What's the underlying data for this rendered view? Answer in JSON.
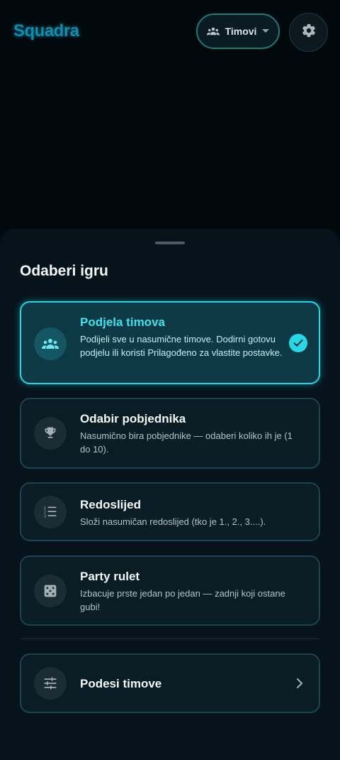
{
  "header": {
    "logo": "Squadra",
    "mode_label": "Timovi"
  },
  "sheet": {
    "title": "Odaberi igru",
    "games": [
      {
        "title": "Podjela timova",
        "description": "Podijeli sve u nasumične timove. Dodirni gotovu podjelu ili koristi Prilagođeno za vlastite postavke.",
        "icon": "groups-icon",
        "selected": true
      },
      {
        "title": "Odabir pobjednika",
        "description": "Nasumično bira pobjednike — odaberi koliko ih je (1 do 10).",
        "icon": "trophy-icon",
        "selected": false
      },
      {
        "title": "Redoslijed",
        "description": "Složi nasumičan redoslijed (tko je 1., 2., 3....).",
        "icon": "numbered-list-icon",
        "selected": false
      },
      {
        "title": "Party rulet",
        "description": "Izbacuje prste jedan po jedan — zadnji koji ostane gubi!",
        "icon": "dice-icon",
        "selected": false
      }
    ],
    "settings_row": {
      "label": "Podesi timove",
      "icon": "tune-icon"
    }
  },
  "colors": {
    "accent": "#22d6e4",
    "background": "#02090d",
    "sheet": "#06131a",
    "card": "#0a1c24",
    "selected_card": "#0d3a44"
  }
}
